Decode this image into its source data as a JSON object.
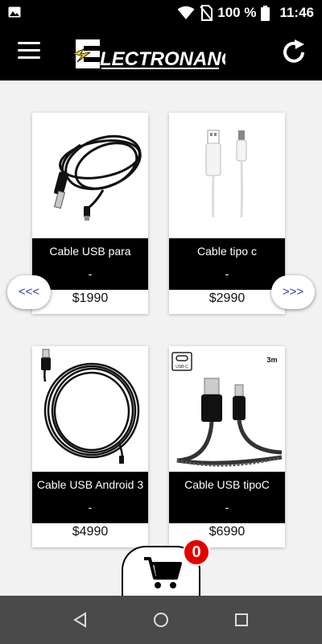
{
  "status_bar": {
    "battery_text": "100 %",
    "time": "11:46"
  },
  "app_bar": {
    "logo_text": "LECTRONANO",
    "logo_initial": "E"
  },
  "products": [
    {
      "name": "Cable USB para",
      "description": "-",
      "price": "$1990",
      "image": "black-mini-usb-cable"
    },
    {
      "name": "Cable tipo c",
      "description": "-",
      "price": "$2990",
      "image": "white-usb-c-cable"
    },
    {
      "name": "Cable USB Android 3",
      "description": "-",
      "price": "$4990",
      "image": "black-micro-usb-coil-cable"
    },
    {
      "name": "Cable USB tipoC",
      "description": "-",
      "price": "$6990",
      "image": "braided-usb-c-cable"
    }
  ],
  "image_labels": {
    "usb_c_tag": "USB-C",
    "length_tag": "3m"
  },
  "pager": {
    "prev_label": "<<<",
    "next_label": ">>>"
  },
  "cart": {
    "count": "0"
  }
}
